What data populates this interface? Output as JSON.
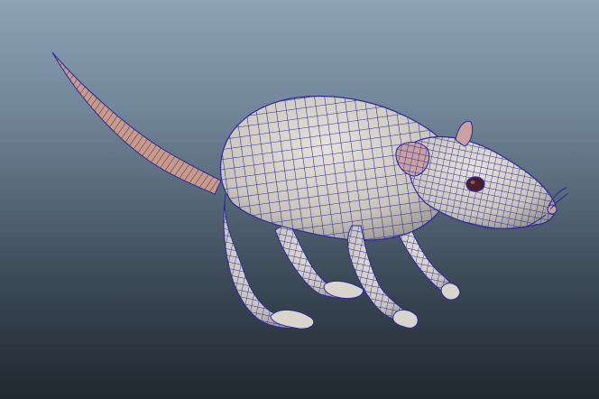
{
  "viewport": {
    "background_top": "#8fa3b6",
    "background_bottom": "#1f2730"
  },
  "model": {
    "subject": "rat",
    "display_mode": "shaded-wireframe",
    "body_color": "#d9d5cc",
    "wire_color": "#2a2aa0",
    "tail_color": "#c99a86",
    "ear_inner_color": "#c9a1a1",
    "eye_color": "#4a1f2a"
  }
}
